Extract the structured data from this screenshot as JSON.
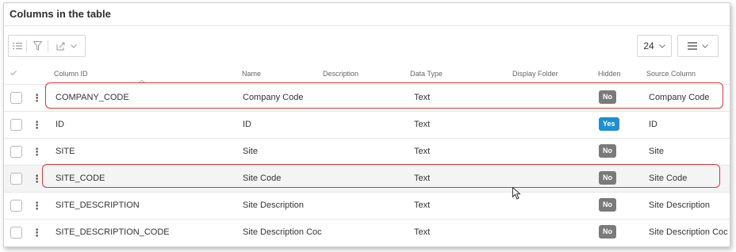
{
  "panel": {
    "title": "Columns in the table"
  },
  "toolbar": {
    "page_size": "24"
  },
  "columns": {
    "column_id": "Column ID",
    "name": "Name",
    "description": "Description",
    "data_type": "Data Type",
    "display_folder": "Display Folder",
    "hidden": "Hidden",
    "source_column": "Source Column"
  },
  "rows": [
    {
      "column_id": "COMPANY_CODE",
      "name": "Company Code",
      "data_type": "Text",
      "hidden": "No",
      "source_column": "Company Code",
      "highlighted": true,
      "selected": false
    },
    {
      "column_id": "ID",
      "name": "ID",
      "data_type": "Text",
      "hidden": "Yes",
      "source_column": "ID",
      "highlighted": false,
      "selected": false
    },
    {
      "column_id": "SITE",
      "name": "Site",
      "data_type": "Text",
      "hidden": "No",
      "source_column": "Site",
      "highlighted": false,
      "selected": false
    },
    {
      "column_id": "SITE_CODE",
      "name": "Site Code",
      "data_type": "Text",
      "hidden": "No",
      "source_column": "Site Code",
      "highlighted": true,
      "selected": true
    },
    {
      "column_id": "SITE_DESCRIPTION",
      "name": "Site Description",
      "data_type": "Text",
      "hidden": "No",
      "source_column": "Site Description",
      "highlighted": false,
      "selected": false
    },
    {
      "column_id": "SITE_DESCRIPTION_CODE",
      "name": "Site Description Coc",
      "data_type": "Text",
      "hidden": "No",
      "source_column": "Site Description Coc",
      "highlighted": false,
      "selected": false
    }
  ],
  "colors": {
    "highlight": "#d33a3a",
    "yes_badge": "#1e8fd2",
    "no_badge": "#7a7a7a"
  }
}
